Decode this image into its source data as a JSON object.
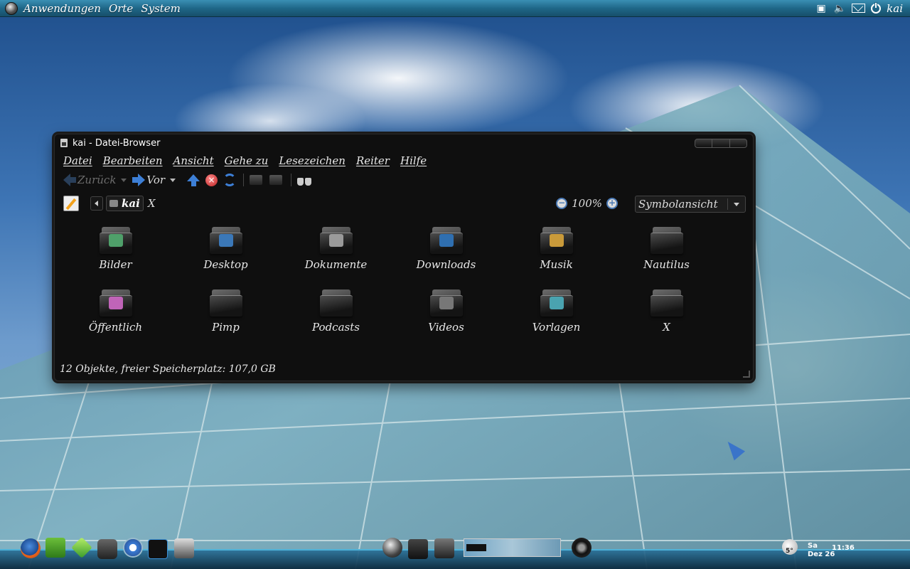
{
  "top_panel": {
    "menus": [
      "Anwendungen",
      "Orte",
      "System"
    ],
    "user": "kai"
  },
  "window": {
    "title": "kai - Datei-Browser",
    "menubar": [
      "Datei",
      "Bearbeiten",
      "Ansicht",
      "Gehe zu",
      "Lesezeichen",
      "Reiter",
      "Hilfe"
    ],
    "toolbar": {
      "back_label": "Zurück",
      "forward_label": "Vor"
    },
    "location": {
      "crumb": "kai",
      "close_label": "X",
      "zoom": "100%",
      "view": "Symbolansicht"
    },
    "items": [
      {
        "label": "Bilder",
        "emblem": "#4fa06a"
      },
      {
        "label": "Desktop",
        "emblem": "#3b78b8"
      },
      {
        "label": "Dokumente",
        "emblem": "#9a9a9a"
      },
      {
        "label": "Downloads",
        "emblem": "#2f6fb0"
      },
      {
        "label": "Musik",
        "emblem": "#c99a3a"
      },
      {
        "label": "Nautilus",
        "emblem": ""
      },
      {
        "label": "Öffentlich",
        "emblem": "#c064b8"
      },
      {
        "label": "Pimp",
        "emblem": ""
      },
      {
        "label": "Podcasts",
        "emblem": ""
      },
      {
        "label": "Videos",
        "emblem": "#777777"
      },
      {
        "label": "Vorlagen",
        "emblem": "#4aa3b0"
      },
      {
        "label": "X",
        "emblem": ""
      }
    ],
    "status": "12 Objekte, freier Speicherplatz: 107,0 GB"
  },
  "dock": {
    "day": "Sa",
    "date": "Dez 26",
    "time": "11:36",
    "temperature": "5°"
  }
}
